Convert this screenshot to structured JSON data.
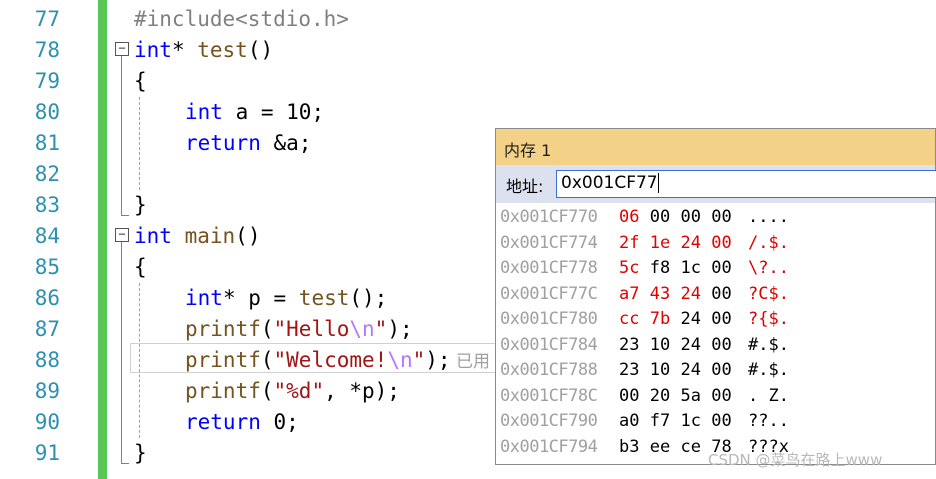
{
  "editor": {
    "line_numbers": [
      "77",
      "78",
      "79",
      "80",
      "81",
      "82",
      "83",
      "84",
      "85",
      "86",
      "87",
      "88",
      "89",
      "90",
      "91"
    ],
    "lines": {
      "l77": "#include<stdio.h>",
      "l78_kw": "int",
      "l78_rest": "* ",
      "l78_fn": "test",
      "l78_tail": "()",
      "l79": "{",
      "l80_kw": "int",
      "l80_rest": " a = 10;",
      "l81_kw": "return",
      "l81_rest": " &a;",
      "l83": "}",
      "l84_kw": "int",
      "l84_sp": " ",
      "l84_fn": "main",
      "l84_tail": "()",
      "l85": "{",
      "l86_kw": "int",
      "l86_rest": "* p = ",
      "l86_fn": "test",
      "l86_tail": "();",
      "l87_fn": "printf",
      "l87_open": "(",
      "l87_str1": "\"Hello",
      "l87_esc": "\\n",
      "l87_str2": "\"",
      "l87_close": ");",
      "l88_fn": "printf",
      "l88_open": "(",
      "l88_str1": "\"Welcome!",
      "l88_esc": "\\n",
      "l88_str2": "\"",
      "l88_close": ");",
      "l88_hint": "已用",
      "l89_fn": "printf",
      "l89_open": "(",
      "l89_str": "\"%d\"",
      "l89_rest": ", *p);",
      "l90_kw": "return",
      "l90_rest": " 0;",
      "l91": "}"
    },
    "collapse_glyph": "−"
  },
  "memory_window": {
    "title": "内存 1",
    "address_label": "地址:",
    "address_value": "0x001CF77",
    "rows": [
      {
        "addr": "0x001CF770",
        "b1": "06",
        "b2": "00",
        "b3": "00",
        "b4": "00",
        "ascii": "....",
        "red": [
          true,
          false,
          false,
          false
        ],
        "ascii_red": false
      },
      {
        "addr": "0x001CF774",
        "b1": "2f",
        "b2": "1e",
        "b3": "24",
        "b4": "00",
        "ascii": "/.$.",
        "red": [
          true,
          true,
          true,
          true
        ],
        "ascii_red": true
      },
      {
        "addr": "0x001CF778",
        "b1": "5c",
        "b2": "f8",
        "b3": "1c",
        "b4": "00",
        "ascii": "\\?..",
        "red": [
          true,
          false,
          false,
          false
        ],
        "ascii_red": true
      },
      {
        "addr": "0x001CF77C",
        "b1": "a7",
        "b2": "43",
        "b3": "24",
        "b4": "00",
        "ascii": "?C$.",
        "red": [
          true,
          true,
          true,
          false
        ],
        "ascii_red": true
      },
      {
        "addr": "0x001CF780",
        "b1": "cc",
        "b2": "7b",
        "b3": "24",
        "b4": "00",
        "ascii": "?{$.",
        "red": [
          true,
          true,
          false,
          false
        ],
        "ascii_red": true
      },
      {
        "addr": "0x001CF784",
        "b1": "23",
        "b2": "10",
        "b3": "24",
        "b4": "00",
        "ascii": "#.$.",
        "red": [
          false,
          false,
          false,
          false
        ],
        "ascii_red": false
      },
      {
        "addr": "0x001CF788",
        "b1": "23",
        "b2": "10",
        "b3": "24",
        "b4": "00",
        "ascii": "#.$.",
        "red": [
          false,
          false,
          false,
          false
        ],
        "ascii_red": false
      },
      {
        "addr": "0x001CF78C",
        "b1": "00",
        "b2": "20",
        "b3": "5a",
        "b4": "00",
        "ascii": ". Z.",
        "red": [
          false,
          false,
          false,
          false
        ],
        "ascii_red": false
      },
      {
        "addr": "0x001CF790",
        "b1": "a0",
        "b2": "f7",
        "b3": "1c",
        "b4": "00",
        "ascii": "??..",
        "red": [
          false,
          false,
          false,
          false
        ],
        "ascii_red": false
      },
      {
        "addr": "0x001CF794",
        "b1": "b3",
        "b2": "ee",
        "b3": "ce",
        "b4": "78",
        "ascii": "???x",
        "red": [
          false,
          false,
          false,
          false
        ],
        "ascii_red": false
      }
    ]
  },
  "watermark": "CSDN @菜鸟在路上www",
  "colors": {
    "line_number": "#2b91af",
    "keyword": "#0000ff",
    "string": "#a31515",
    "changed_byte": "#e00000",
    "title_bar": "#f3d187",
    "address_bar": "#dce1f0",
    "change_bar": "#57c757"
  }
}
